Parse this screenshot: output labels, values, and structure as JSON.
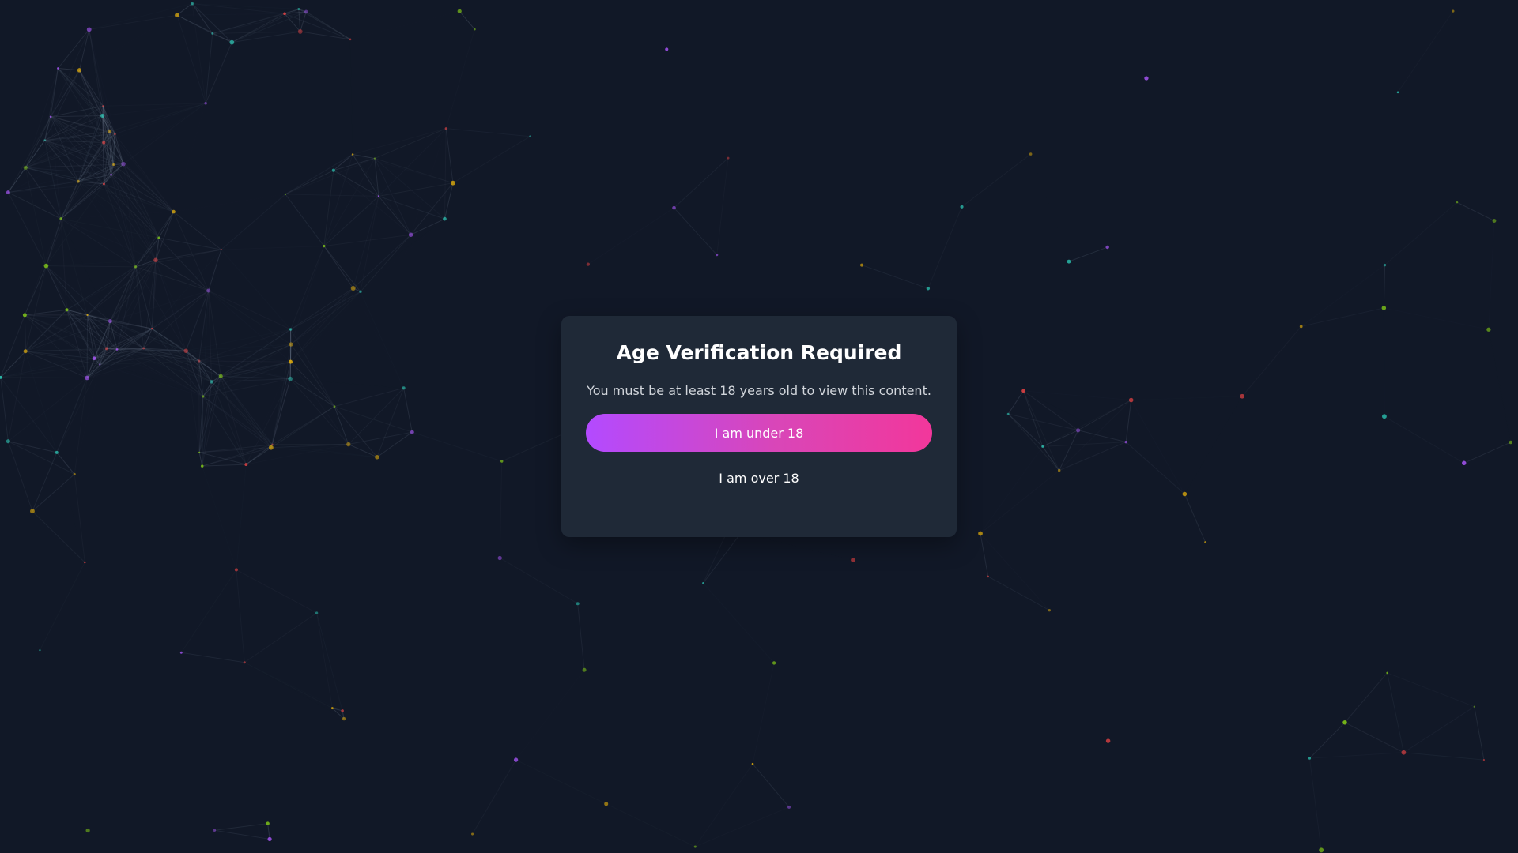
{
  "background": {
    "color": "#111827",
    "node_colors": [
      "#2dd4bf",
      "#a855f7",
      "#eab308",
      "#ef4444",
      "#84cc16"
    ],
    "line_color": "#94a3b8"
  },
  "modal": {
    "title": "Age Verification Required",
    "message": "You must be at least 18 years old to view this content.",
    "under_button_label": "I am under 18",
    "over_button_label": "I am over 18",
    "accent_gradient": [
      "#b34aff",
      "#f2379b"
    ]
  }
}
